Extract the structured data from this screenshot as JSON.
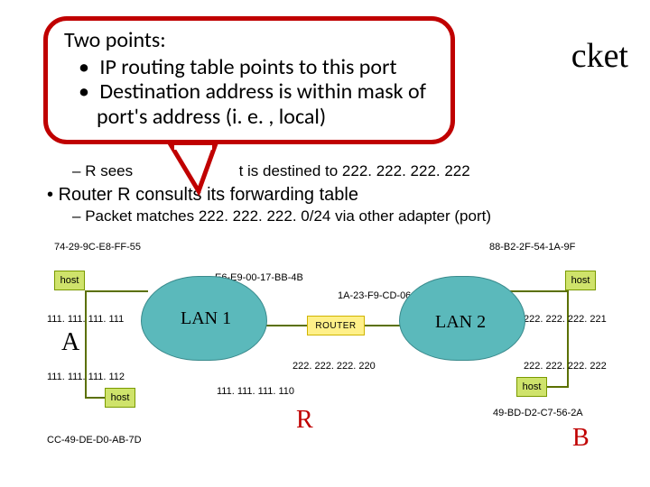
{
  "callout": {
    "title": "Two points:",
    "items": [
      "IP routing table points to this port",
      "Destination address is within mask of port's address (i. e. , local)"
    ]
  },
  "title_fragment": "cket",
  "body": {
    "sub1_partial_prefix": "R sees",
    "sub1_partial_suffix": "t is destined to 222. 222. 222. 222",
    "bullet1": "Router R consults its forwarding table",
    "sub2": "Packet matches 222. 222. 222. 0/24 via other adapter (port)"
  },
  "diagram": {
    "mac": {
      "hostA": "74-29-9C-E8-FF-55",
      "r_lan1": "E6-E9-00-17-BB-4B",
      "r_lan2": "1A-23-F9-CD-06-9B",
      "hostB_top": "88-B2-2F-54-1A-9F",
      "hostA2": "CC-49-DE-D0-AB-7D",
      "hostB_bot": "49-BD-D2-C7-56-2A"
    },
    "ip": {
      "hostA": "111. 111. 111. 111",
      "hostA2": "111. 111. 111. 112",
      "r_lan1": "111. 111. 111. 110",
      "r_lan2": "222. 222. 222. 220",
      "hostB_top": "222. 222. 222. 221",
      "hostB_bot": "222. 222. 222. 222"
    },
    "labels": {
      "host": "host",
      "router": "ROUTER",
      "lan1": "LAN 1",
      "lan2": "LAN 2",
      "A": "A",
      "B": "B",
      "R": "R"
    }
  }
}
